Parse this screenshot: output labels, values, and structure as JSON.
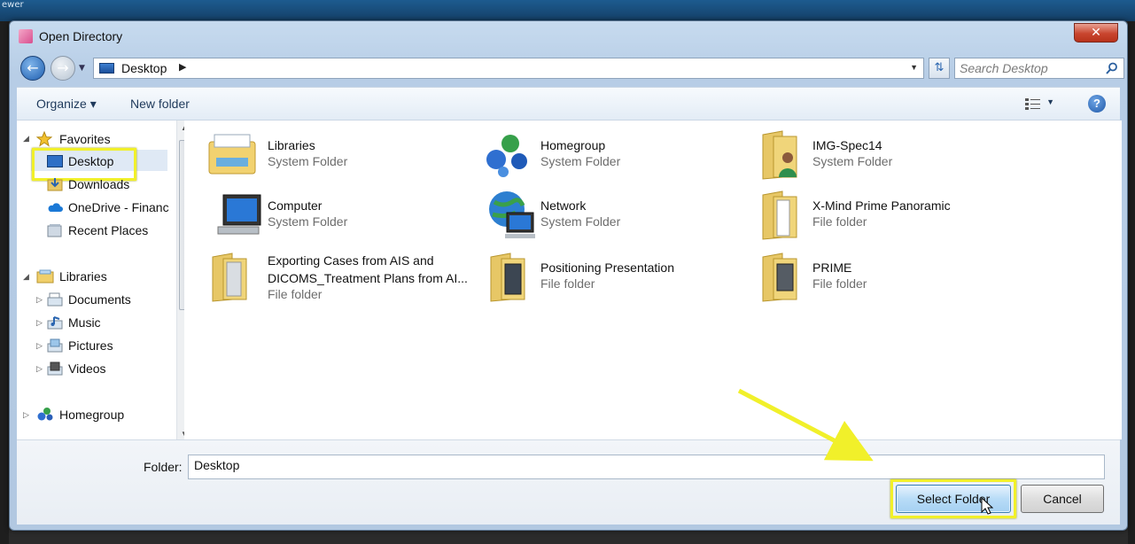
{
  "background": {
    "label": "ewer"
  },
  "window": {
    "title": "Open Directory",
    "close_glyph": "✕"
  },
  "nav": {
    "back_glyph": "←",
    "forward_glyph": "→",
    "address": "Desktop",
    "address_separator": "▶",
    "refresh_glyph": "⇅",
    "search_placeholder": "Search Desktop"
  },
  "toolbar": {
    "organize": "Organize ▾",
    "new_folder": "New folder",
    "help": "?"
  },
  "sidebar": {
    "favorites": "Favorites",
    "desktop": "Desktop",
    "downloads": "Downloads",
    "onedrive": "OneDrive - Financ",
    "recent": "Recent Places",
    "libraries": "Libraries",
    "documents": "Documents",
    "music": "Music",
    "pictures": "Pictures",
    "videos": "Videos",
    "homegroup": "Homegroup"
  },
  "items": [
    {
      "name": "Libraries",
      "type": "System Folder",
      "icon": "libraries-icon"
    },
    {
      "name": "Homegroup",
      "type": "System Folder",
      "icon": "homegroup-icon"
    },
    {
      "name": "IMG-Spec14",
      "type": "System Folder",
      "icon": "user-folder-icon"
    },
    {
      "name": "Computer",
      "type": "System Folder",
      "icon": "computer-icon"
    },
    {
      "name": "Network",
      "type": "System Folder",
      "icon": "network-icon"
    },
    {
      "name": "X-Mind Prime Panoramic",
      "type": "File folder",
      "icon": "folder-icon"
    },
    {
      "name": "Exporting Cases from AIS and DICOMS_Treatment Plans from AI...",
      "type": "File folder",
      "icon": "folder-icon"
    },
    {
      "name": "Positioning Presentation",
      "type": "File folder",
      "icon": "folder-icon"
    },
    {
      "name": "PRIME",
      "type": "File folder",
      "icon": "folder-icon"
    }
  ],
  "footer": {
    "folder_label": "Folder:",
    "folder_value": "Desktop",
    "select_button": "Select Folder",
    "cancel_button": "Cancel"
  },
  "colors": {
    "highlight": "#f1f02a",
    "accent": "#1f5fb0"
  }
}
